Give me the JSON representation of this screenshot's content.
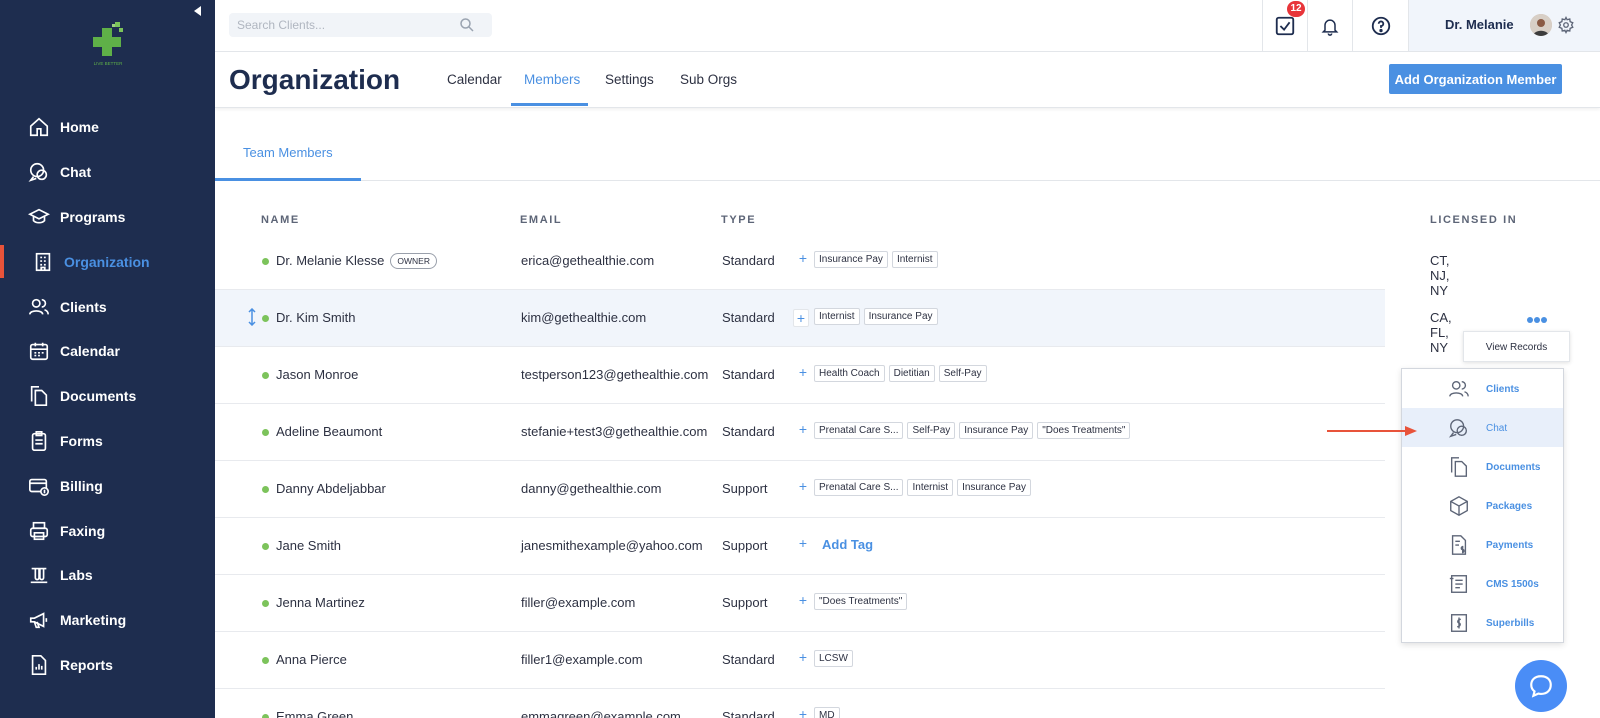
{
  "sidebar": {
    "logo_text": "LIVE BETTER",
    "items": [
      {
        "label": "Home",
        "icon": "home-icon"
      },
      {
        "label": "Chat",
        "icon": "chat-icon"
      },
      {
        "label": "Programs",
        "icon": "graduation-cap-icon"
      },
      {
        "label": "Organization",
        "icon": "building-icon",
        "active": true
      },
      {
        "label": "Clients",
        "icon": "users-icon"
      },
      {
        "label": "Calendar",
        "icon": "calendar-icon"
      },
      {
        "label": "Documents",
        "icon": "documents-icon"
      },
      {
        "label": "Forms",
        "icon": "clipboard-icon"
      },
      {
        "label": "Billing",
        "icon": "billing-icon"
      },
      {
        "label": "Faxing",
        "icon": "printer-icon"
      },
      {
        "label": "Labs",
        "icon": "test-tubes-icon"
      },
      {
        "label": "Marketing",
        "icon": "megaphone-icon"
      },
      {
        "label": "Reports",
        "icon": "report-icon"
      }
    ]
  },
  "topbar": {
    "search_placeholder": "Search Clients...",
    "task_count": "12",
    "user_name": "Dr. Melanie"
  },
  "header": {
    "title": "Organization",
    "tabs": [
      "Calendar",
      "Members",
      "Settings",
      "Sub Orgs"
    ],
    "active_tab": "Members",
    "add_button": "Add Organization Member"
  },
  "subtab": "Team Members",
  "table": {
    "columns": {
      "name": "NAME",
      "email": "EMAIL",
      "type": "TYPE",
      "licensed": "LICENSED IN"
    },
    "rows": [
      {
        "name": "Dr. Melanie Klesse",
        "owner": "OWNER",
        "email": "erica@gethealthie.com",
        "type": "Standard",
        "tags": [
          "Insurance Pay",
          "Internist"
        ],
        "licensed": "CT, NJ, NY"
      },
      {
        "name": "Dr. Kim Smith",
        "email": "kim@gethealthie.com",
        "type": "Standard",
        "tags": [
          "Internist",
          "Insurance Pay"
        ],
        "licensed": "CA, FL, NY"
      },
      {
        "name": "Jason Monroe",
        "email": "testperson123@gethealthie.com",
        "type": "Standard",
        "tags": [
          "Health Coach",
          "Dietitian",
          "Self-Pay"
        ],
        "licensed": ""
      },
      {
        "name": "Adeline Beaumont",
        "email": "stefanie+test3@gethealthie.com",
        "type": "Standard",
        "tags": [
          "Prenatal Care S...",
          "Self-Pay",
          "Insurance Pay",
          "\"Does Treatments\""
        ],
        "licensed": ""
      },
      {
        "name": "Danny Abdeljabbar",
        "email": "danny@gethealthie.com",
        "type": "Support",
        "tags": [
          "Prenatal Care S...",
          "Internist",
          "Insurance Pay"
        ],
        "licensed": ""
      },
      {
        "name": "Jane Smith",
        "email": "janesmithexample@yahoo.com",
        "type": "Support",
        "tags": [],
        "add_tag": "Add Tag",
        "licensed": ""
      },
      {
        "name": "Jenna Martinez",
        "email": "filler@example.com",
        "type": "Support",
        "tags": [
          "\"Does Treatments\""
        ],
        "licensed": ""
      },
      {
        "name": "Anna Pierce",
        "email": "filler1@example.com",
        "type": "Standard",
        "tags": [
          "LCSW"
        ],
        "licensed": ""
      },
      {
        "name": "Emma Green",
        "email": "emmagreen@example.com",
        "type": "Standard",
        "tags": [
          "MD"
        ],
        "licensed": ""
      }
    ]
  },
  "tooltip": "View Records",
  "menu": [
    {
      "label": "Clients",
      "icon": "users-icon"
    },
    {
      "label": "Chat",
      "icon": "chat-icon",
      "active": true
    },
    {
      "label": "Documents",
      "icon": "documents-icon"
    },
    {
      "label": "Packages",
      "icon": "package-icon"
    },
    {
      "label": "Payments",
      "icon": "payment-icon"
    },
    {
      "label": "CMS 1500s",
      "icon": "cms-form-icon"
    },
    {
      "label": "Superbills",
      "icon": "superbill-icon"
    }
  ],
  "colors": {
    "sidebar": "#1e2d4f",
    "accent": "#4a90e2",
    "active_bar": "#e8533a",
    "arrow": "#e8533a",
    "status": "#7cc35b"
  }
}
